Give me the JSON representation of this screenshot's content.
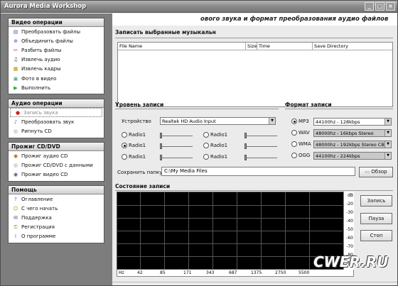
{
  "window": {
    "title": "Aurora Media Workshop"
  },
  "sidebar": {
    "video": {
      "title": "Видео операции",
      "items": [
        {
          "label": "Преобразовать файлы",
          "icon": "film-icon"
        },
        {
          "label": "Объединить файлы",
          "icon": "merge-icon"
        },
        {
          "label": "Разбить файлы",
          "icon": "split-icon"
        },
        {
          "label": "Извлечь аудио",
          "icon": "music-icon"
        },
        {
          "label": "Извлечь кадры",
          "icon": "frames-icon"
        },
        {
          "label": "Фото в видео",
          "icon": "photo-icon"
        },
        {
          "label": "Выполнить",
          "icon": "run-icon"
        }
      ]
    },
    "audio": {
      "title": "Аудио операции",
      "items": [
        {
          "label": "Запись звука",
          "icon": "record-icon"
        },
        {
          "label": "Преобразовать звук",
          "icon": "convert-audio-icon"
        },
        {
          "label": "Рипнуть CD",
          "icon": "cd-icon"
        }
      ]
    },
    "burn": {
      "title": "Прожиг CD/DVD",
      "items": [
        {
          "label": "Прожиг аудио CD",
          "icon": "cd-burn-icon"
        },
        {
          "label": "Прожиг CD/DVD с данными",
          "icon": "disc-data-icon"
        },
        {
          "label": "Прожиг видео CD",
          "icon": "video-cd-icon"
        }
      ]
    },
    "help": {
      "title": "Помощь",
      "items": [
        {
          "label": "Оглавление",
          "icon": "help-icon"
        },
        {
          "label": "С чего начать",
          "icon": "smile-icon"
        },
        {
          "label": "Поддержка",
          "icon": "support-icon"
        },
        {
          "label": "Регистрация",
          "icon": "key-icon"
        },
        {
          "label": "О программе",
          "icon": "info-icon"
        }
      ]
    }
  },
  "main": {
    "banner": "ового звука  и формат преобразования аудио файлов",
    "record_section": "Записать выбранные музыкальн",
    "list_headers": [
      "File Name",
      "Size",
      "Time",
      "Save Directory"
    ],
    "level_section": "Уровень записи",
    "device_label": "Устройство",
    "device_value": "Realtek HD Audio Input",
    "radios": [
      "Radio1",
      "Radio1",
      "Radio1",
      "Radio1",
      "Radio1",
      "Radio1"
    ],
    "format_section": "Формат записи",
    "formats": [
      {
        "label": "MP3",
        "value": "44100hz - 128kbps",
        "selected": true
      },
      {
        "label": "WAV",
        "value": "48000hz - 16kbps Stereo",
        "selected": false
      },
      {
        "label": "WMA",
        "value": "48000hz - 192kbps Stereo CB",
        "selected": false
      },
      {
        "label": "OGG",
        "value": "44100hz - 224kbps",
        "selected": false
      }
    ],
    "save_label": "Сохранить папку",
    "save_path": "C:\\My Media Files",
    "browse_label": "Обзор",
    "status_section": "Состояние записи",
    "db_unit": "dB",
    "db_ticks": [
      "-20",
      "-30",
      "-40",
      "-50",
      "-60",
      "-70",
      "-80",
      "-90"
    ],
    "hz_ticks": [
      "Hz",
      "42",
      "85",
      "171",
      "343",
      "687",
      "1375",
      "2750",
      "5500"
    ],
    "buttons": {
      "record": "Запись",
      "pause": "Пауза",
      "stop": "Стоп"
    }
  },
  "watermark": "CWER.RU"
}
